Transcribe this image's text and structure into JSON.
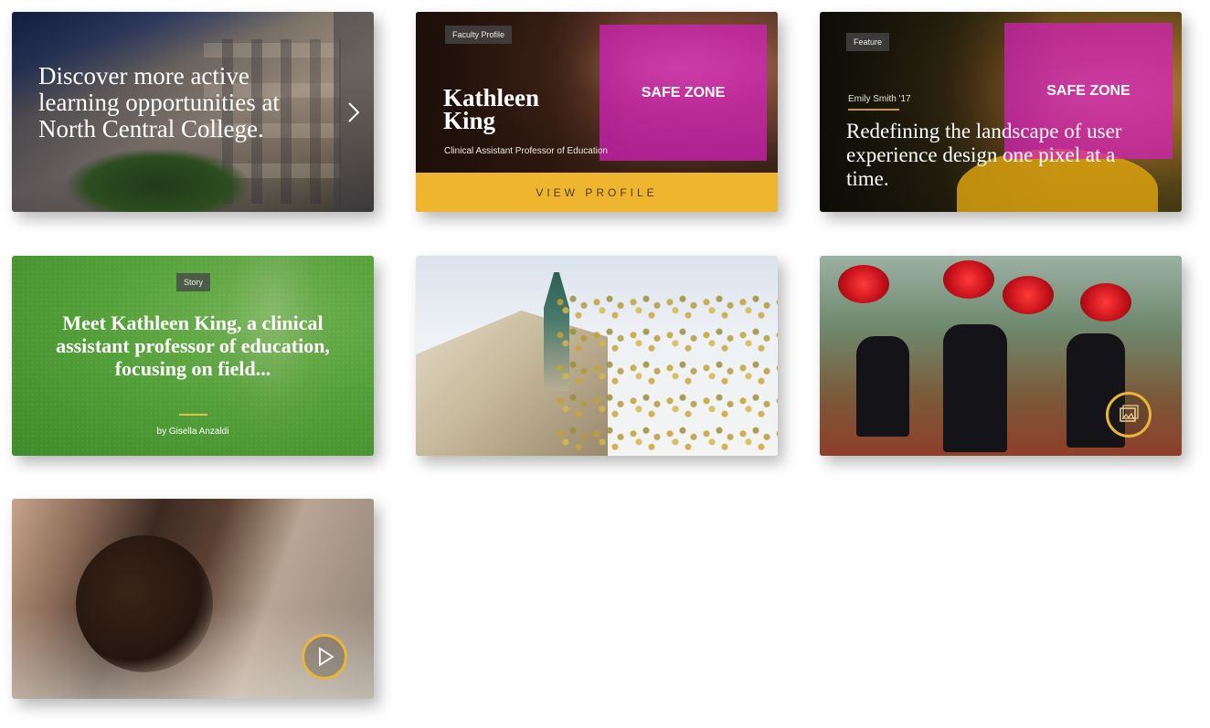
{
  "cards": {
    "promo": {
      "title": "Discover more active learning opportunities at North Central College."
    },
    "faculty": {
      "tag": "Faculty Profile",
      "name_first": "Kathleen",
      "name_last": "King",
      "role": "Clinical Assistant Professor of Education",
      "safe_zone": "SAFE ZONE",
      "cta": "VIEW PROFILE"
    },
    "feature": {
      "tag": "Feature",
      "byline": "Emily Smith '17",
      "safe_zone": "SAFE ZONE",
      "headline": "Redefining the landscape of user experience design one pixel at a time."
    },
    "story": {
      "tag": "Story",
      "headline": "Meet Kathleen King, a clinical assistant professor of education, focusing on field...",
      "author": "by Gisella Anzaldi"
    },
    "photo": {
      "icon": "image-icon"
    },
    "gallery": {
      "icon": "gallery-icon"
    },
    "video": {
      "icon": "play-icon"
    }
  },
  "colors": {
    "safe_zone": "#d620bd",
    "cta_yellow": "#f0b52e",
    "ring_gold": "#e8b638",
    "story_green": "#54a039"
  }
}
